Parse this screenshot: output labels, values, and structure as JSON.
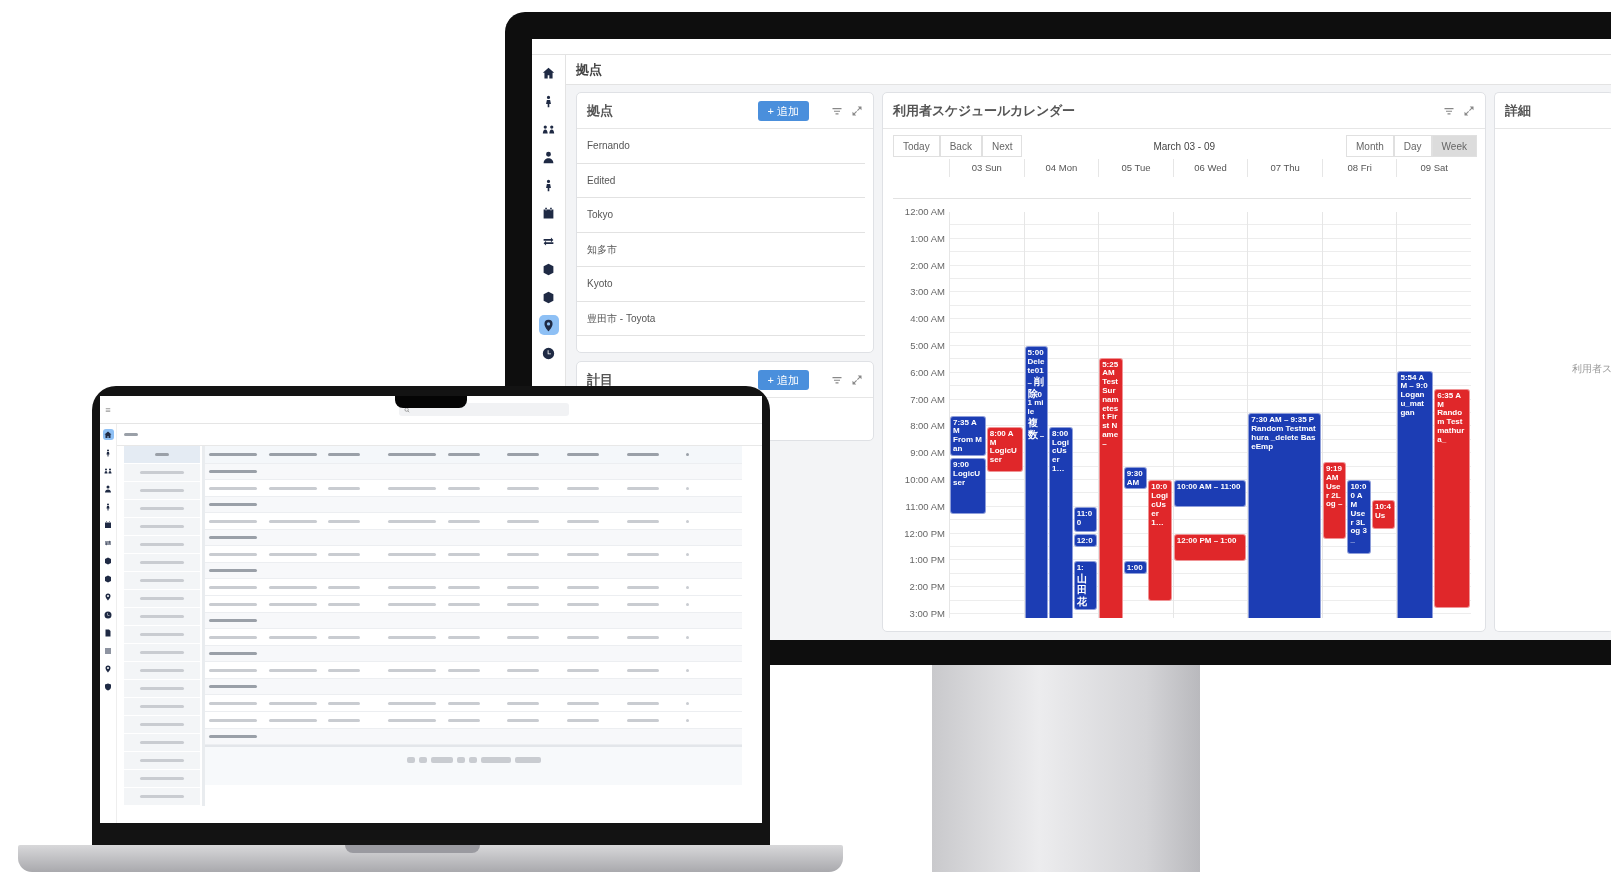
{
  "monitor": {
    "sidebar": [
      {
        "selected": false
      },
      {
        "selected": false
      },
      {
        "selected": false
      },
      {
        "selected": false
      },
      {
        "selected": false
      },
      {
        "selected": false
      },
      {
        "selected": false
      },
      {
        "selected": false
      },
      {
        "selected": false
      },
      {
        "selected": true
      },
      {
        "selected": false
      }
    ],
    "page_title": "拠点",
    "locations_panel": {
      "title": "拠点",
      "add_button": "+ 追加",
      "items": [
        "Fernando",
        "Edited",
        "Tokyo",
        "知多市",
        "Kyoto",
        "豊田市 - Toyota"
      ]
    },
    "second_panel": {
      "title": "計目",
      "add_button": "+ 追加"
    },
    "calendar": {
      "title": "利用者スケジュールカレンダー",
      "nav_buttons": [
        "Today",
        "Back",
        "Next"
      ],
      "range": "March 03 - 09",
      "views": [
        {
          "label": "Month",
          "selected": false
        },
        {
          "label": "Day",
          "selected": false
        },
        {
          "label": "Week",
          "selected": true
        }
      ],
      "time_labels": [
        "12:00 AM",
        "1:00 AM",
        "2:00 AM",
        "3:00 AM",
        "4:00 AM",
        "5:00 AM",
        "6:00 AM",
        "7:00 AM",
        "8:00 AM",
        "9:00 AM",
        "10:00 AM",
        "11:00 AM",
        "12:00 PM",
        "1:00 PM",
        "2:00 PM",
        "3:00 PM"
      ],
      "days": [
        {
          "label": "03 Sun",
          "events": [
            {
              "time": "7:35 AM",
              "title": "From Man",
              "color": "#1c3db4"
            },
            {
              "time": "8:00 AM",
              "title": "LogicUser",
              "color": "#e0272a"
            },
            {
              "time": "9:00",
              "title": "LogicUser",
              "color": "#1c3db4"
            }
          ]
        },
        {
          "label": "04 Mon",
          "events": [
            {
              "time": "5:00",
              "title": "Delete01 – 削除01 mile 複数 –",
              "color": "#1c3db4"
            },
            {
              "time": "8:00",
              "title": "LogicUser 1…",
              "color": "#1c3db4"
            },
            {
              "time": "11:00",
              "color": "#1c3db4"
            },
            {
              "time": "12:0",
              "color": "#1c3db4"
            },
            {
              "time": "1:",
              "title": "山田花",
              "color": "#1c3db4"
            }
          ]
        },
        {
          "label": "05 Tue",
          "events": [
            {
              "time": "5:25 AM",
              "title": "Test Surnametest First Name –",
              "color": "#e0272a"
            },
            {
              "time": "9:30 AM",
              "color": "#1c3db4"
            },
            {
              "time": "10:0",
              "title": "LogicUser 1…",
              "color": "#e0272a"
            },
            {
              "time": "1:00",
              "color": "#1c3db4"
            }
          ]
        },
        {
          "label": "06 Wed",
          "events": [
            {
              "time": "10:00 AM – 11:00",
              "color": "#1c3db4"
            },
            {
              "time": "12:00 PM – 1:00",
              "color": "#e0272a"
            }
          ]
        },
        {
          "label": "07 Thu",
          "events": [
            {
              "time": "7:30 AM – 9:35 P",
              "title": "Random Testmathura _delete BaseEmp",
              "color": "#1c3db4"
            }
          ]
        },
        {
          "label": "08 Fri",
          "events": [
            {
              "time": "9:19 AM",
              "title": "User 2Log –",
              "color": "#e0272a"
            },
            {
              "time": "10:00 AM",
              "title": "User 3Log 3_",
              "color": "#1c3db4"
            },
            {
              "time": "10:4",
              "title": "Us",
              "color": "#e0272a"
            }
          ]
        },
        {
          "label": "09 Sat",
          "events": [
            {
              "time": "5:54 AM – 9:0",
              "title": "Logan u_mat gan",
              "color": "#1c3db4"
            },
            {
              "time": "6:35 AM",
              "title": "Random Test mathura_",
              "color": "#e0272a"
            }
          ]
        }
      ]
    },
    "detail_panel": {
      "title": "詳細",
      "hint": "利用者ス"
    }
  },
  "laptop": {
    "sidebar": [
      {
        "selected": true
      },
      {
        "selected": false
      },
      {
        "selected": false
      },
      {
        "selected": false
      },
      {
        "selected": false
      },
      {
        "selected": false
      },
      {
        "selected": false
      },
      {
        "selected": false
      },
      {
        "selected": false
      },
      {
        "selected": false
      },
      {
        "selected": false
      },
      {
        "selected": false
      },
      {
        "selected": false
      },
      {
        "selected": false
      },
      {
        "selected": false
      }
    ],
    "date_list": [
      {
        "selected": true
      },
      {
        "selected": false
      },
      {
        "selected": false
      },
      {
        "selected": false
      },
      {
        "selected": false
      },
      {
        "selected": false
      },
      {
        "selected": false
      },
      {
        "selected": false
      },
      {
        "selected": false
      },
      {
        "selected": false
      },
      {
        "selected": false
      },
      {
        "selected": false
      },
      {
        "selected": false
      },
      {
        "selected": false
      },
      {
        "selected": false
      },
      {
        "selected": false
      },
      {
        "selected": false
      },
      {
        "selected": false
      },
      {
        "selected": false
      },
      {
        "selected": false
      }
    ]
  }
}
